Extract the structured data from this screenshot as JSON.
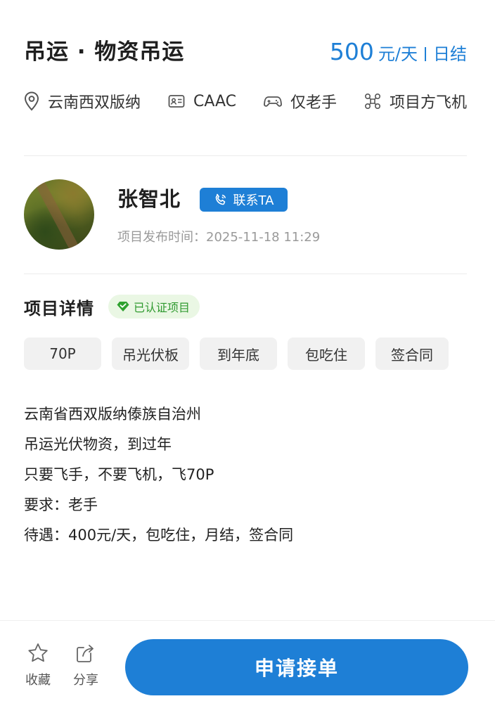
{
  "job": {
    "title": "吊运 · 物资吊运",
    "price_amount": "500",
    "price_unit": "元/天",
    "settlement": "日结"
  },
  "meta": {
    "location": "云南西双版纳",
    "license": "CAAC",
    "experience": "仅老手",
    "aircraft": "项目方飞机"
  },
  "poster": {
    "name": "张智北",
    "contact_label": "联系TA",
    "publish_time": "项目发布时间：2025-11-18 11:29"
  },
  "details": {
    "section_title": "项目详情",
    "verified_label": "已认证项目",
    "tags": [
      "70P",
      "吊光伏板",
      "到年底",
      "包吃住",
      "签合同"
    ],
    "description": [
      "云南省西双版纳傣族自治州",
      "吊运光伏物资，到过年",
      "只要飞手，不要飞机，飞70P",
      "要求：老手",
      "待遇：400元/天，包吃住，月结，签合同"
    ]
  },
  "bottom_bar": {
    "favorite_label": "收藏",
    "share_label": "分享",
    "apply_label": "申请接单"
  },
  "colors": {
    "accent": "#1e7fd6",
    "verified_bg": "#eaf7e4",
    "verified_text": "#2f9a2f",
    "tag_bg": "#f1f1f1"
  },
  "icons": {
    "location": "location-pin-icon",
    "license": "id-card-icon",
    "experience": "gamepad-icon",
    "aircraft": "drone-icon",
    "contact": "phone-icon",
    "verified": "verified-diamond-icon",
    "favorite": "star-icon",
    "share": "share-icon"
  }
}
